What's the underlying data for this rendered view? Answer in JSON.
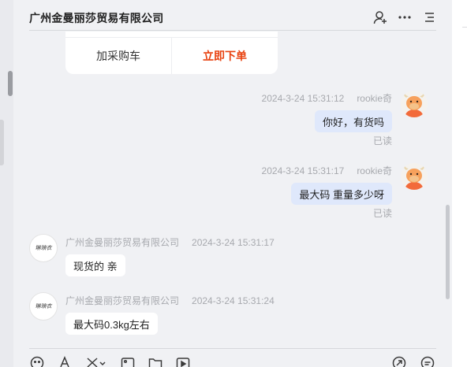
{
  "header": {
    "title": "广州金曼丽莎贸易有限公司",
    "icons": [
      "add-user-icon",
      "more-icon",
      "menu-icon"
    ]
  },
  "order_card": {
    "cart_label": "加采购车",
    "buy_label": "立即下单"
  },
  "messages": [
    {
      "sender": "rookie奇",
      "time": "2024-3-24 15:31:12",
      "text": "你好，有货吗",
      "status": "已读",
      "side": "me"
    },
    {
      "sender": "rookie奇",
      "time": "2024-3-24 15:31:17",
      "text": "最大码  重量多少呀",
      "status": "已读",
      "side": "me"
    },
    {
      "sender": "广州金曼丽莎贸易有限公司",
      "time": "2024-3-24 15:31:17",
      "text": "现货的 亲",
      "side": "them"
    },
    {
      "sender": "广州金曼丽莎贸易有限公司",
      "time": "2024-3-24 15:31:24",
      "text": "最大码0.3kg左右",
      "side": "them"
    }
  ],
  "shop_avatar_text": "琳琅衣",
  "toolbar": {
    "icons": [
      "emoji-icon",
      "font-icon",
      "scissors-icon",
      "image-icon",
      "folder-icon",
      "video-icon",
      "send-icon",
      "quick-reply-icon"
    ]
  },
  "colors": {
    "accent_buy": "#e8410f",
    "bubble_me": "#dfe8fb",
    "bubble_them": "#ffffff",
    "background": "#f0f1f4"
  }
}
